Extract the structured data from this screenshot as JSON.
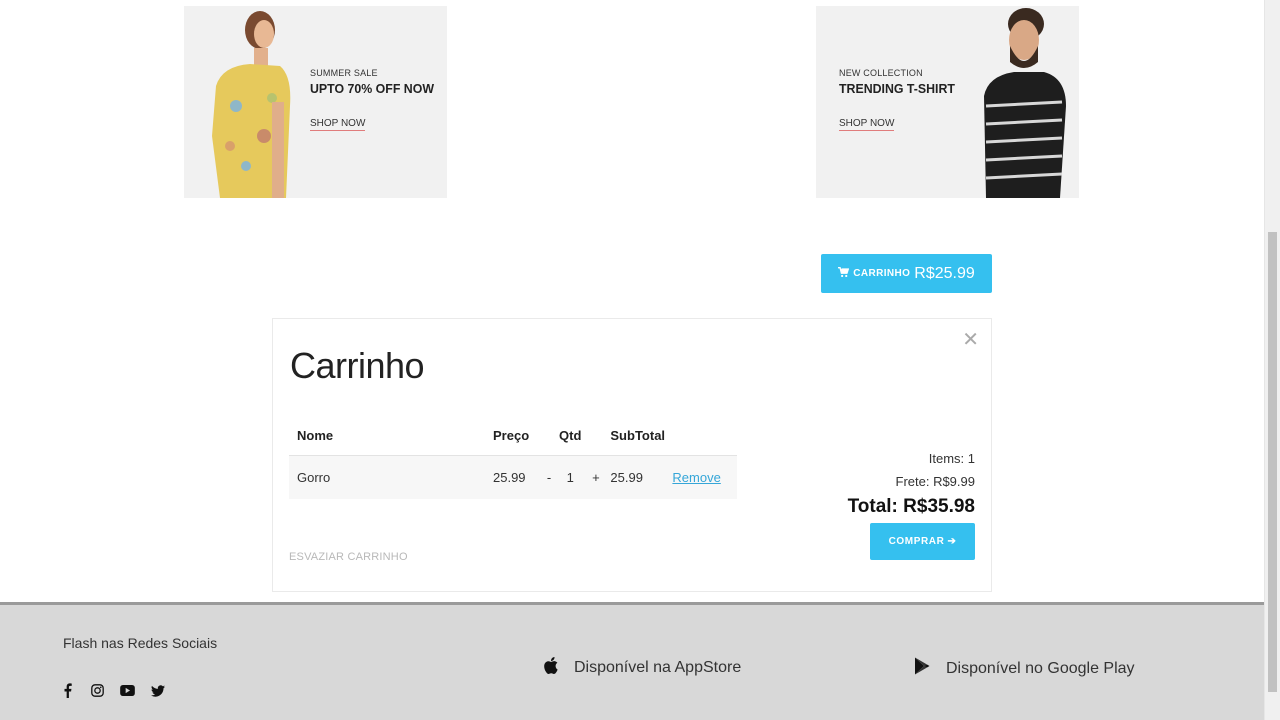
{
  "banners": {
    "left": {
      "small": "SUMMER SALE",
      "big": "UPTO 70% OFF NOW",
      "link": "SHOP NOW"
    },
    "right": {
      "small": "NEW COLLECTION",
      "big": "TRENDING T-SHIRT",
      "link": "SHOP NOW"
    }
  },
  "cart_button": {
    "label": "CARRINHO",
    "total": "R$25.99"
  },
  "cart": {
    "title": "Carrinho",
    "columns": {
      "name": "Nome",
      "price": "Preço",
      "qty": "Qtd",
      "subtotal": "SubTotal"
    },
    "items": [
      {
        "name": "Gorro",
        "price": "25.99",
        "minus": "-",
        "qty": "1",
        "plus": "+",
        "subtotal": "25.99",
        "remove": "Remove"
      }
    ],
    "empty_label": "ESVAZIAR CARRINHO",
    "summary": {
      "items": "Items: 1",
      "shipping": "Frete: R$9.99",
      "total": "Total: R$35.98"
    },
    "buy_label": "COMPRAR"
  },
  "footer": {
    "social_title": "Flash nas Redes Sociais",
    "social_icons": [
      "facebook-icon",
      "instagram-icon",
      "youtube-icon",
      "twitter-icon"
    ],
    "appstore_label": "Disponível na AppStore",
    "googleplay_label": "Disponível no Google Play"
  },
  "colors": {
    "accent": "#35c0ef",
    "link": "#35a6d8",
    "footer_bg": "#d8d8d8"
  }
}
